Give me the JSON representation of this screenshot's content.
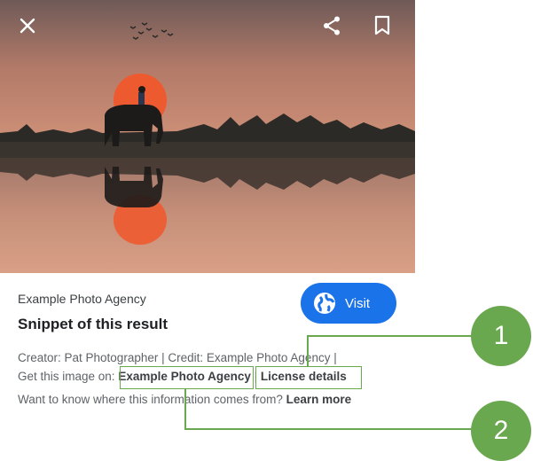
{
  "header": {
    "close_icon": "close-icon",
    "share_icon": "share-icon",
    "bookmark_icon": "bookmark-icon"
  },
  "result": {
    "source": "Example Photo Agency",
    "title": "Snippet of this result",
    "visit_label": "Visit",
    "visit_icon": "globe-icon",
    "visit_color": "#1a73e8"
  },
  "credits": {
    "line1": "Creator: Pat Photographer | Credit: Example Photo Agency |",
    "line2_prefix": "Get this image on:",
    "agency_link": "Example Photo Agency",
    "separator": "|",
    "license_link": "License details",
    "line3_prefix": "Want to know where this information comes from?",
    "learn_more": "Learn more"
  },
  "callouts": [
    {
      "label": "1",
      "color": "#6aa84f"
    },
    {
      "label": "2",
      "color": "#6aa84f"
    }
  ]
}
